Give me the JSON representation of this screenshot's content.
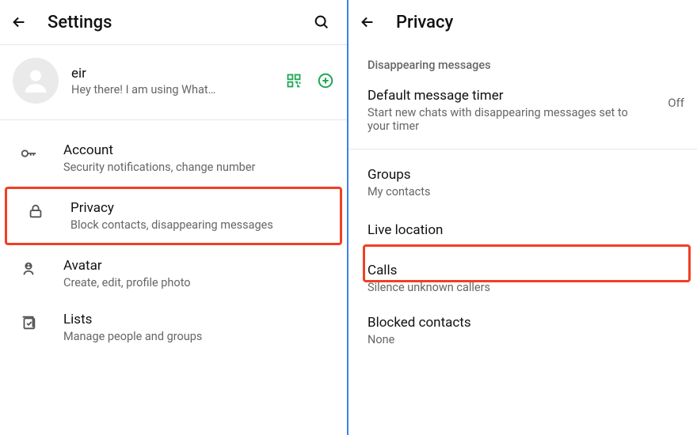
{
  "left": {
    "header": {
      "title": "Settings"
    },
    "profile": {
      "name": "eir",
      "status": "Hey there! I am using What…"
    },
    "items": [
      {
        "title": "Account",
        "subtitle": "Security notifications, change number"
      },
      {
        "title": "Privacy",
        "subtitle": "Block contacts, disappearing messages"
      },
      {
        "title": "Avatar",
        "subtitle": "Create, edit, profile photo"
      },
      {
        "title": "Lists",
        "subtitle": "Manage people and groups"
      }
    ]
  },
  "right": {
    "header": {
      "title": "Privacy"
    },
    "section": "Disappearing messages",
    "timer": {
      "title": "Default message timer",
      "subtitle": "Start new chats with disappearing messages set to your timer",
      "value": "Off"
    },
    "items": [
      {
        "title": "Groups",
        "subtitle": "My contacts"
      },
      {
        "title": "Live location",
        "subtitle": ""
      },
      {
        "title": "Calls",
        "subtitle": "Silence unknown callers"
      },
      {
        "title": "Blocked contacts",
        "subtitle": "None"
      }
    ]
  }
}
